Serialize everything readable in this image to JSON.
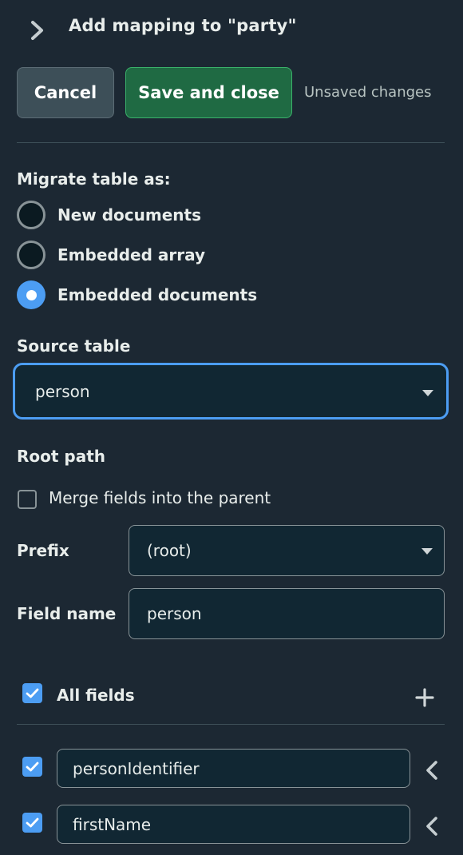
{
  "header": {
    "title": "Add mapping to \"party\"",
    "chevron_icon": "chevron-right-icon"
  },
  "actions": {
    "cancel_label": "Cancel",
    "save_label": "Save and close",
    "status_text": "Unsaved changes"
  },
  "migrate": {
    "label": "Migrate table as:",
    "options": [
      {
        "label": "New documents",
        "selected": false
      },
      {
        "label": "Embedded array",
        "selected": false
      },
      {
        "label": "Embedded documents",
        "selected": true
      }
    ]
  },
  "source_table": {
    "label": "Source table",
    "value": "person"
  },
  "root_path": {
    "label": "Root path",
    "merge_label": "Merge fields into the parent",
    "merge_checked": false,
    "prefix_label": "Prefix",
    "prefix_value": "(root)",
    "field_name_label": "Field name",
    "field_name_value": "person"
  },
  "fields": {
    "all_label": "All fields",
    "all_checked": true,
    "items": [
      {
        "name": "personIdentifier",
        "checked": true
      },
      {
        "name": "firstName",
        "checked": true
      }
    ]
  },
  "colors": {
    "accent_blue": "#4c9df3",
    "save_green": "#1f6a43",
    "background": "#1c2833"
  }
}
